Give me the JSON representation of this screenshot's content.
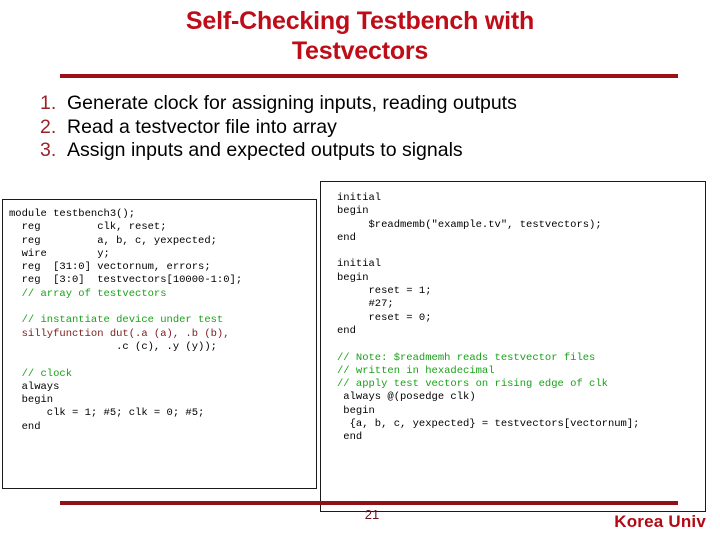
{
  "slide": {
    "title": "Self-Checking Testbench with Testvectors",
    "title_line1": "Self-Checking Testbench with",
    "title_line2": "Testvectors",
    "accent_color": "#BE0D18",
    "rule_color": "#9B1118",
    "comment_color": "#18A218",
    "identifier_color": "#7B2020"
  },
  "bullets": [
    {
      "number": "1.",
      "text": "Generate clock for assigning inputs, reading outputs"
    },
    {
      "number": "2.",
      "text": "Read a testvector file into array"
    },
    {
      "number": "3.",
      "text": "Assign inputs and expected outputs to signals"
    }
  ],
  "code_left": {
    "lines": [
      {
        "text": "module testbench3();",
        "style": "plain"
      },
      {
        "text": "  reg         clk, reset;",
        "style": "plain"
      },
      {
        "text": "  reg         a, b, c, yexpected;",
        "style": "plain"
      },
      {
        "text": "  wire        y;",
        "style": "plain"
      },
      {
        "text": "  reg  [31:0] vectornum, errors;",
        "style": "plain"
      },
      {
        "text": "  reg  [3:0]  testvectors[10000-1:0];",
        "style": "plain"
      },
      {
        "text": "  // array of testvectors",
        "style": "comment"
      },
      {
        "text": "",
        "style": "plain"
      },
      {
        "text": "  // instantiate device under test",
        "style": "comment"
      },
      {
        "text": "  sillyfunction dut(.a (a), .b (b),",
        "style": "identifier"
      },
      {
        "text": "                 .c (c), .y (y));",
        "style": "plain"
      },
      {
        "text": "",
        "style": "plain"
      },
      {
        "text": "  // clock",
        "style": "comment"
      },
      {
        "text": "  always",
        "style": "plain"
      },
      {
        "text": "  begin",
        "style": "plain"
      },
      {
        "text": "      clk = 1; #5; clk = 0; #5;",
        "style": "plain"
      },
      {
        "text": "  end",
        "style": "plain"
      }
    ]
  },
  "code_right": {
    "lines": [
      {
        "text": "initial",
        "style": "plain"
      },
      {
        "text": "begin",
        "style": "plain"
      },
      {
        "text": "     $readmemb(\"example.tv\", testvectors);",
        "style": "plain"
      },
      {
        "text": "end",
        "style": "plain"
      },
      {
        "text": "",
        "style": "plain"
      },
      {
        "text": "initial",
        "style": "plain"
      },
      {
        "text": "begin",
        "style": "plain"
      },
      {
        "text": "     reset = 1;",
        "style": "plain"
      },
      {
        "text": "     #27;",
        "style": "plain"
      },
      {
        "text": "     reset = 0;",
        "style": "plain"
      },
      {
        "text": "end",
        "style": "plain"
      },
      {
        "text": "",
        "style": "plain"
      },
      {
        "text": "// Note: $readmemh reads testvector files",
        "style": "comment"
      },
      {
        "text": "// written in hexadecimal",
        "style": "comment"
      },
      {
        "text": "// apply test vectors on rising edge of clk",
        "style": "comment"
      },
      {
        "text": " always @(posedge clk)",
        "style": "plain"
      },
      {
        "text": " begin",
        "style": "plain"
      },
      {
        "text": "  {a, b, c, yexpected} = testvectors[vectornum];",
        "style": "plain"
      },
      {
        "text": " end",
        "style": "plain"
      }
    ]
  },
  "footer": {
    "page_number": "21",
    "brand": "Korea Univ"
  }
}
